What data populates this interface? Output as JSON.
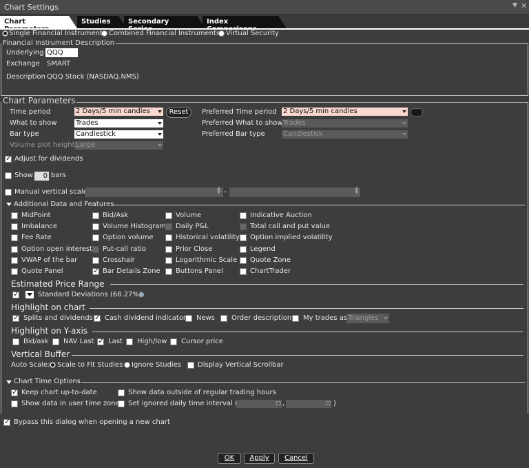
{
  "window": {
    "title": "Chart Settings"
  },
  "tabs": [
    "Chart Parameters",
    "Studies",
    "Secondary Series",
    "Index Comparisons"
  ],
  "instrument_type": {
    "options": [
      "Single Financial Instrument",
      "Combined Financial Instruments",
      "Virtual Security"
    ],
    "selected": "Single Financial Instrument"
  },
  "fin_desc": {
    "title": "Financial Instrument Description",
    "underlying_label": "Underlying",
    "underlying_value": "QQQ",
    "exchange_label": "Exchange",
    "exchange_value": "SMART",
    "description_label": "Description",
    "description_value": "QQQ Stock (NASDAQ.NMS)"
  },
  "chart_params": {
    "title": "Chart Parameters",
    "time_period_label": "Time period",
    "time_period_value": "2 Days/5 min candles",
    "reset_label": "Reset",
    "what_to_show_label": "What to show",
    "what_to_show_value": "Trades",
    "bar_type_label": "Bar type",
    "bar_type_value": "Candlestick",
    "volume_height_label": "Volume plot height",
    "volume_height_value": "Large",
    "pref_time_label": "Preferred Time period",
    "pref_time_value": "2 Days/5 min candles",
    "pref_what_label": "Preferred What to show",
    "pref_what_value": "Trades",
    "pref_bar_label": "Preferred Bar type",
    "pref_bar_value": "Candlestick",
    "adjust_label": "Adjust for dividends",
    "show_label": "Show",
    "show_value": "0",
    "bars_label": "bars",
    "manual_scale_label": "Manual vertical scale",
    "range_sep": "-"
  },
  "additional": {
    "title": "Additional Data and Features",
    "col1": [
      "MidPoint",
      "Imbalance",
      "Fee Rate",
      "Option open interest",
      "VWAP of the bar",
      "Quote Panel"
    ],
    "col2": [
      "Bid/Ask",
      "Volume Histogram",
      "Option volume",
      "Put-call ratio",
      "Crosshair",
      "Bar Details Zone"
    ],
    "col3": [
      "Volume",
      "Daily P&L",
      "Historical volatility",
      "Prior Close",
      "Logarithmic Scale",
      "Buttons Panel"
    ],
    "col4": [
      "Indicative Auction",
      "Total call and put value",
      "Option implied volatility",
      "Legend",
      "Quote Zone",
      "ChartTrader"
    ]
  },
  "estimated_range": {
    "title": "Estimated Price Range",
    "std_label": "Standard Deviations (68.27%)"
  },
  "highlight_chart": {
    "title": "Highlight on chart",
    "items": [
      "Splits and dividends",
      "Cash dividend indicator",
      "News",
      "Order description",
      "My trades as"
    ],
    "my_trades_value": "Triangles"
  },
  "highlight_y": {
    "title": "Highlight on Y-axis",
    "items": [
      "Bid/ask",
      "NAV Last",
      "Last",
      "High/low",
      "Cursor price"
    ]
  },
  "vertical_buffer": {
    "title": "Vertical Buffer",
    "auto_scale_label": "Auto Scale:",
    "scale_fit": "Scale to Fit Studies",
    "ignore": "Ignore Studies",
    "scrollbar": "Display Vertical Scrollbar"
  },
  "time_options": {
    "title": "Chart Time Options",
    "keep_label": "Keep chart up-to-date",
    "outside_label": "Show data outside of regular trading hours",
    "user_tz_label": "Show data in user time zone",
    "ignored_label": "Set ignored daily time interval (",
    "comma": ",",
    "close_paren": ")"
  },
  "bypass_label": "Bypass this dialog when opening a new chart",
  "buttons": {
    "ok": "OK",
    "apply": "Apply",
    "cancel": "Cancel"
  }
}
